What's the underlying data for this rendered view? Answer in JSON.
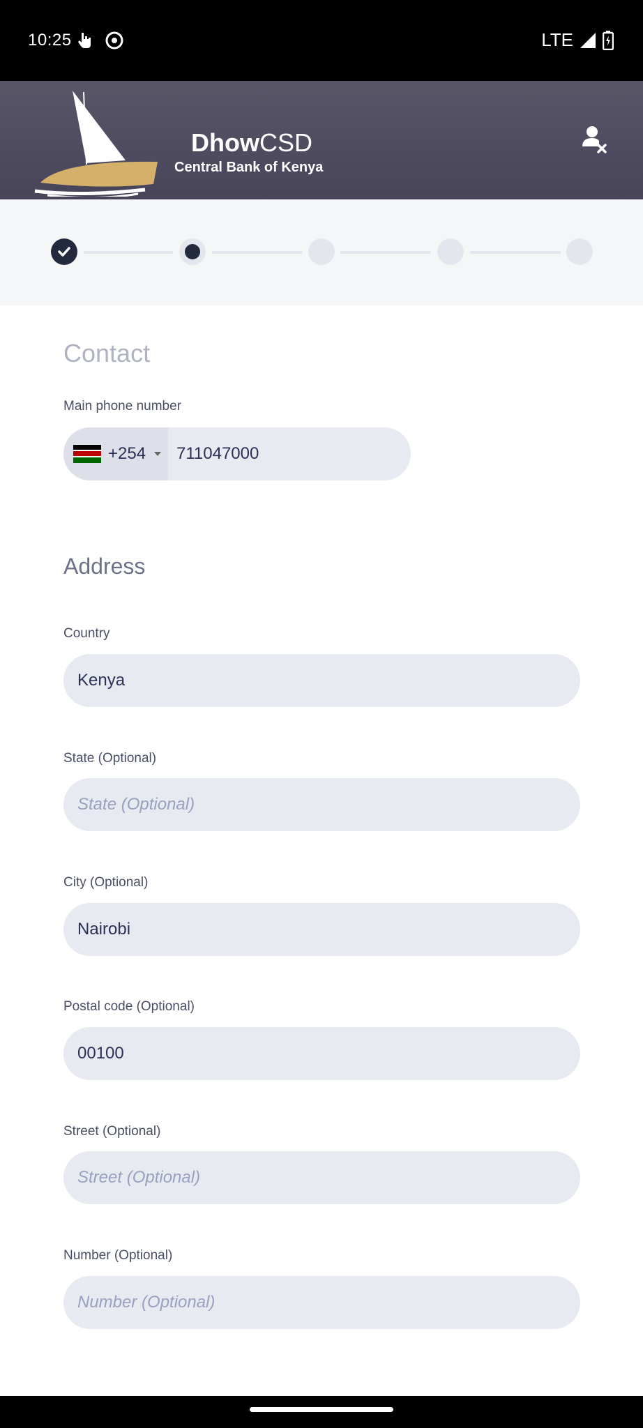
{
  "status_bar": {
    "time": "10:25",
    "network": "LTE",
    "icons": [
      "touch-icon",
      "vpn-icon",
      "signal-icon",
      "battery-icon"
    ]
  },
  "header": {
    "brand_bold": "Dhow",
    "brand_light": "CSD",
    "subtitle": "Central Bank of Kenya",
    "logout_icon": "user-remove-icon"
  },
  "stepper": {
    "steps": [
      {
        "state": "done"
      },
      {
        "state": "current"
      },
      {
        "state": "pending"
      },
      {
        "state": "pending"
      },
      {
        "state": "pending"
      }
    ]
  },
  "contact": {
    "title": "Contact",
    "phone_label": "Main phone number",
    "dial_code": "+254",
    "phone_value": "711047000"
  },
  "address": {
    "title": "Address",
    "fields": [
      {
        "label": "Country",
        "value": "Kenya",
        "placeholder": ""
      },
      {
        "label": "State (Optional)",
        "value": "",
        "placeholder": "State (Optional)"
      },
      {
        "label": "City (Optional)",
        "value": "Nairobi",
        "placeholder": ""
      },
      {
        "label": "Postal code (Optional)",
        "value": "00100",
        "placeholder": ""
      },
      {
        "label": "Street (Optional)",
        "value": "",
        "placeholder": "Street (Optional)"
      },
      {
        "label": "Number (Optional)",
        "value": "",
        "placeholder": "Number (Optional)"
      }
    ]
  },
  "colors": {
    "header": "#4f4b60",
    "accent": "#232a3e",
    "input_bg": "#e8eaf1",
    "sail": "#d4b06a"
  }
}
